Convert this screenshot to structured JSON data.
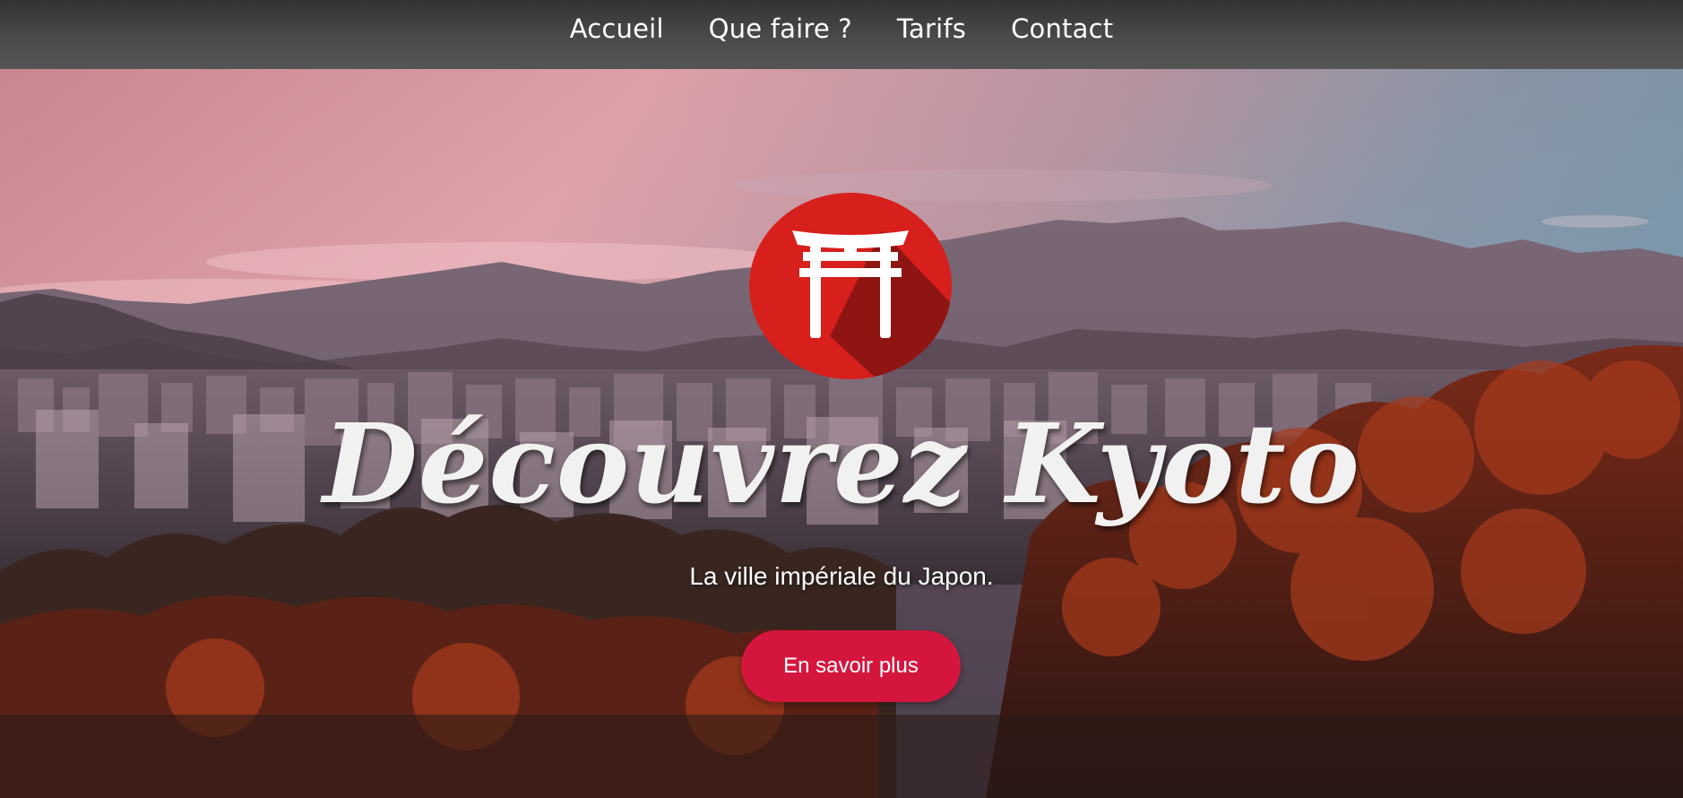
{
  "nav": {
    "items": [
      {
        "label": "Accueil"
      },
      {
        "label": "Que faire ?"
      },
      {
        "label": "Tarifs"
      },
      {
        "label": "Contact"
      }
    ]
  },
  "hero": {
    "logo_icon": "torii-gate-icon",
    "title": "Découvrez Kyoto",
    "subtitle": "La ville impériale du Japon.",
    "cta_label": "En savoir plus"
  },
  "colors": {
    "nav_background": "#4a4a4a",
    "accent": "#d4163e",
    "logo_red": "#d71f1c",
    "title_text": "#f1f1f1"
  }
}
